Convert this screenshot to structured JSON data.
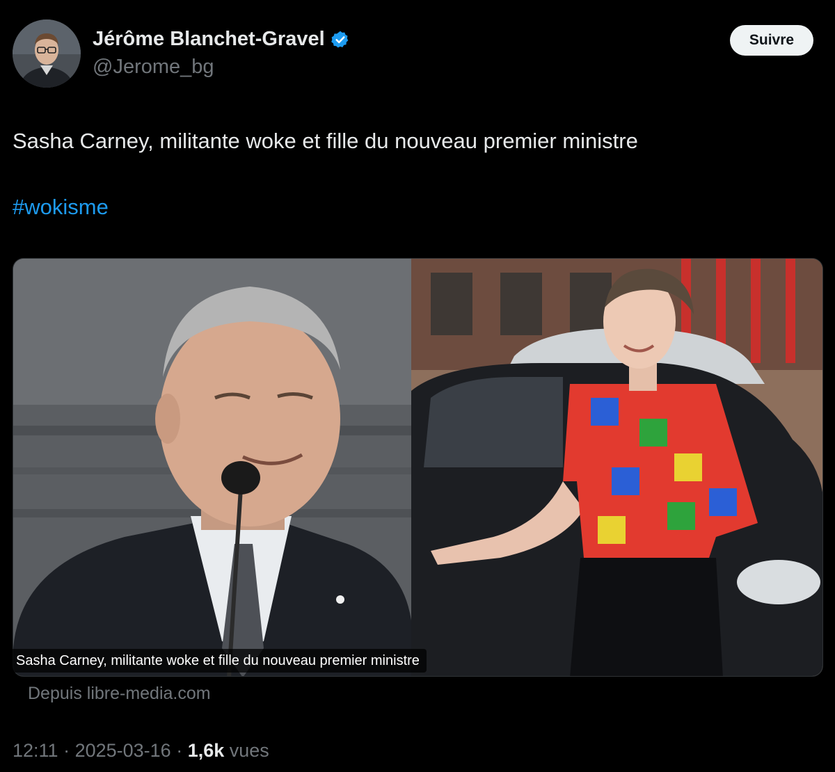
{
  "author": {
    "display_name": "Jérôme Blanchet-Gravel",
    "handle": "@Jerome_bg",
    "verified": true,
    "avatar_icon": "profile-photo"
  },
  "follow_button": {
    "label": "Suivre"
  },
  "tweet": {
    "text": "Sasha Carney, militante woke et fille du nouveau premier ministre",
    "hashtag": "#wokisme"
  },
  "media": {
    "caption": "Sasha Carney, militante woke et fille du nouveau premier ministre",
    "source": "Depuis libre-media.com"
  },
  "meta": {
    "time": "12:11",
    "separator": " · ",
    "date": "2025-03-16",
    "views_count": "1,6k",
    "views_label": " vues"
  },
  "colors": {
    "background": "#000000",
    "text": "#e7e9ea",
    "muted": "#71767b",
    "link": "#1d9bf0",
    "verified": "#1d9bf0"
  }
}
